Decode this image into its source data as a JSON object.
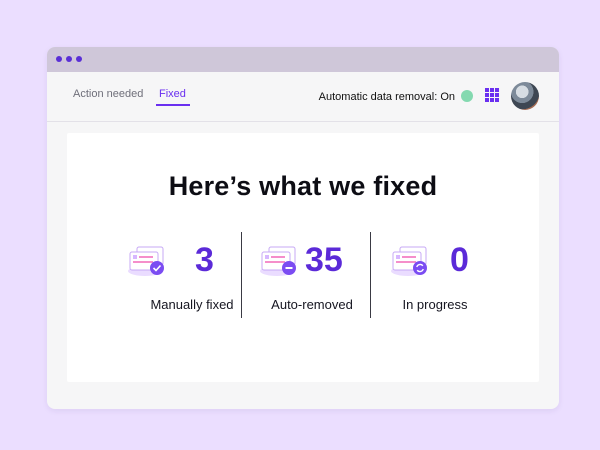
{
  "window": {
    "tabs": [
      {
        "label": "Action needed",
        "active": false
      },
      {
        "label": "Fixed",
        "active": true
      }
    ],
    "auto_removal_label": "Automatic data removal: On",
    "auto_removal_status_color": "#84d9b0",
    "accent_color": "#6a2ff0"
  },
  "main": {
    "headline": "Here’s what we fixed",
    "stats": [
      {
        "value": "3",
        "label": "Manually fixed",
        "icon": "check-badge-icon"
      },
      {
        "value": "35",
        "label": "Auto-removed",
        "icon": "minus-badge-icon"
      },
      {
        "value": "0",
        "label": "In progress",
        "icon": "sync-badge-icon"
      }
    ]
  }
}
